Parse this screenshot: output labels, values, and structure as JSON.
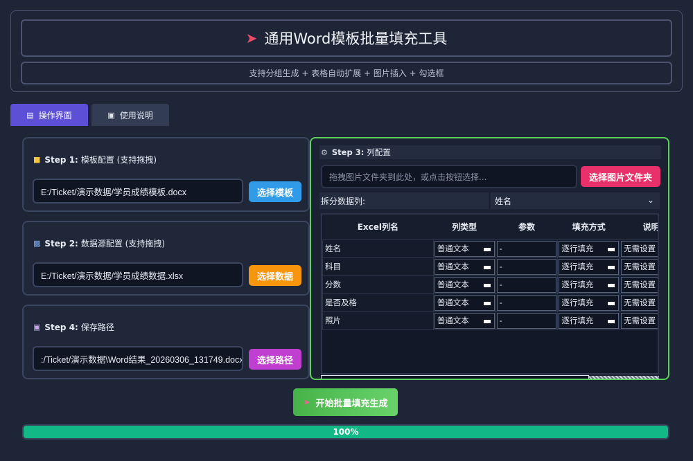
{
  "header": {
    "title_icon": "rocket-icon",
    "title": "通用Word模板批量填充工具",
    "subtitle": "支持分组生成 + 表格自动扩展 + 图片插入 + 勾选框"
  },
  "tabs": [
    {
      "label": "操作界面",
      "icon": "clipboard-icon",
      "active": true
    },
    {
      "label": "使用说明",
      "icon": "book-icon",
      "active": false
    }
  ],
  "steps": {
    "step1": {
      "num": "Step 1:",
      "title": "模板配置 (支持拖拽)",
      "icon": "folder-icon",
      "path": "E:/Ticket/演示数据/学员成绩模板.docx",
      "button": "选择模板",
      "button_color": "#2f9be9"
    },
    "step2": {
      "num": "Step 2:",
      "title": "数据源配置 (支持拖拽)",
      "icon": "bar-chart-icon",
      "path": "E:/Ticket/演示数据/学员成绩数据.xlsx",
      "button": "选择数据",
      "button_color": "#f7950c"
    },
    "step4": {
      "num": "Step 4:",
      "title": "保存路径",
      "icon": "floppy-disk-icon",
      "path": ":/Ticket/演示数据\\Word结果_20260306_131749.docx",
      "button": "选择路径",
      "button_color": "#c03fd0"
    },
    "step3": {
      "num": "Step 3:",
      "title": "列配置",
      "icon": "gear-icon",
      "image_placeholder": "拖拽图片文件夹到此处，或点击按钮选择...",
      "image_button": "选择图片文件夹",
      "split_label": "拆分数据列:",
      "split_value": "姓名",
      "columns": [
        "Excel列名",
        "列类型",
        "参数",
        "填充方式",
        "说明"
      ],
      "rows": [
        {
          "name": "姓名",
          "type": "普通文本",
          "param": "-",
          "fill": "逐行填充",
          "note": "无需设置"
        },
        {
          "name": "科目",
          "type": "普通文本",
          "param": "-",
          "fill": "逐行填充",
          "note": "无需设置"
        },
        {
          "name": "分数",
          "type": "普通文本",
          "param": "-",
          "fill": "逐行填充",
          "note": "无需设置"
        },
        {
          "name": "是否及格",
          "type": "普通文本",
          "param": "-",
          "fill": "逐行填充",
          "note": "无需设置"
        },
        {
          "name": "照片",
          "type": "普通文本",
          "param": "-",
          "fill": "逐行填充",
          "note": "无需设置"
        }
      ]
    }
  },
  "start_button": {
    "label": "开始批量填充生成",
    "icon": "rocket-icon"
  },
  "progress": {
    "value": 1.0,
    "label": "100%",
    "color": "#12b886"
  }
}
